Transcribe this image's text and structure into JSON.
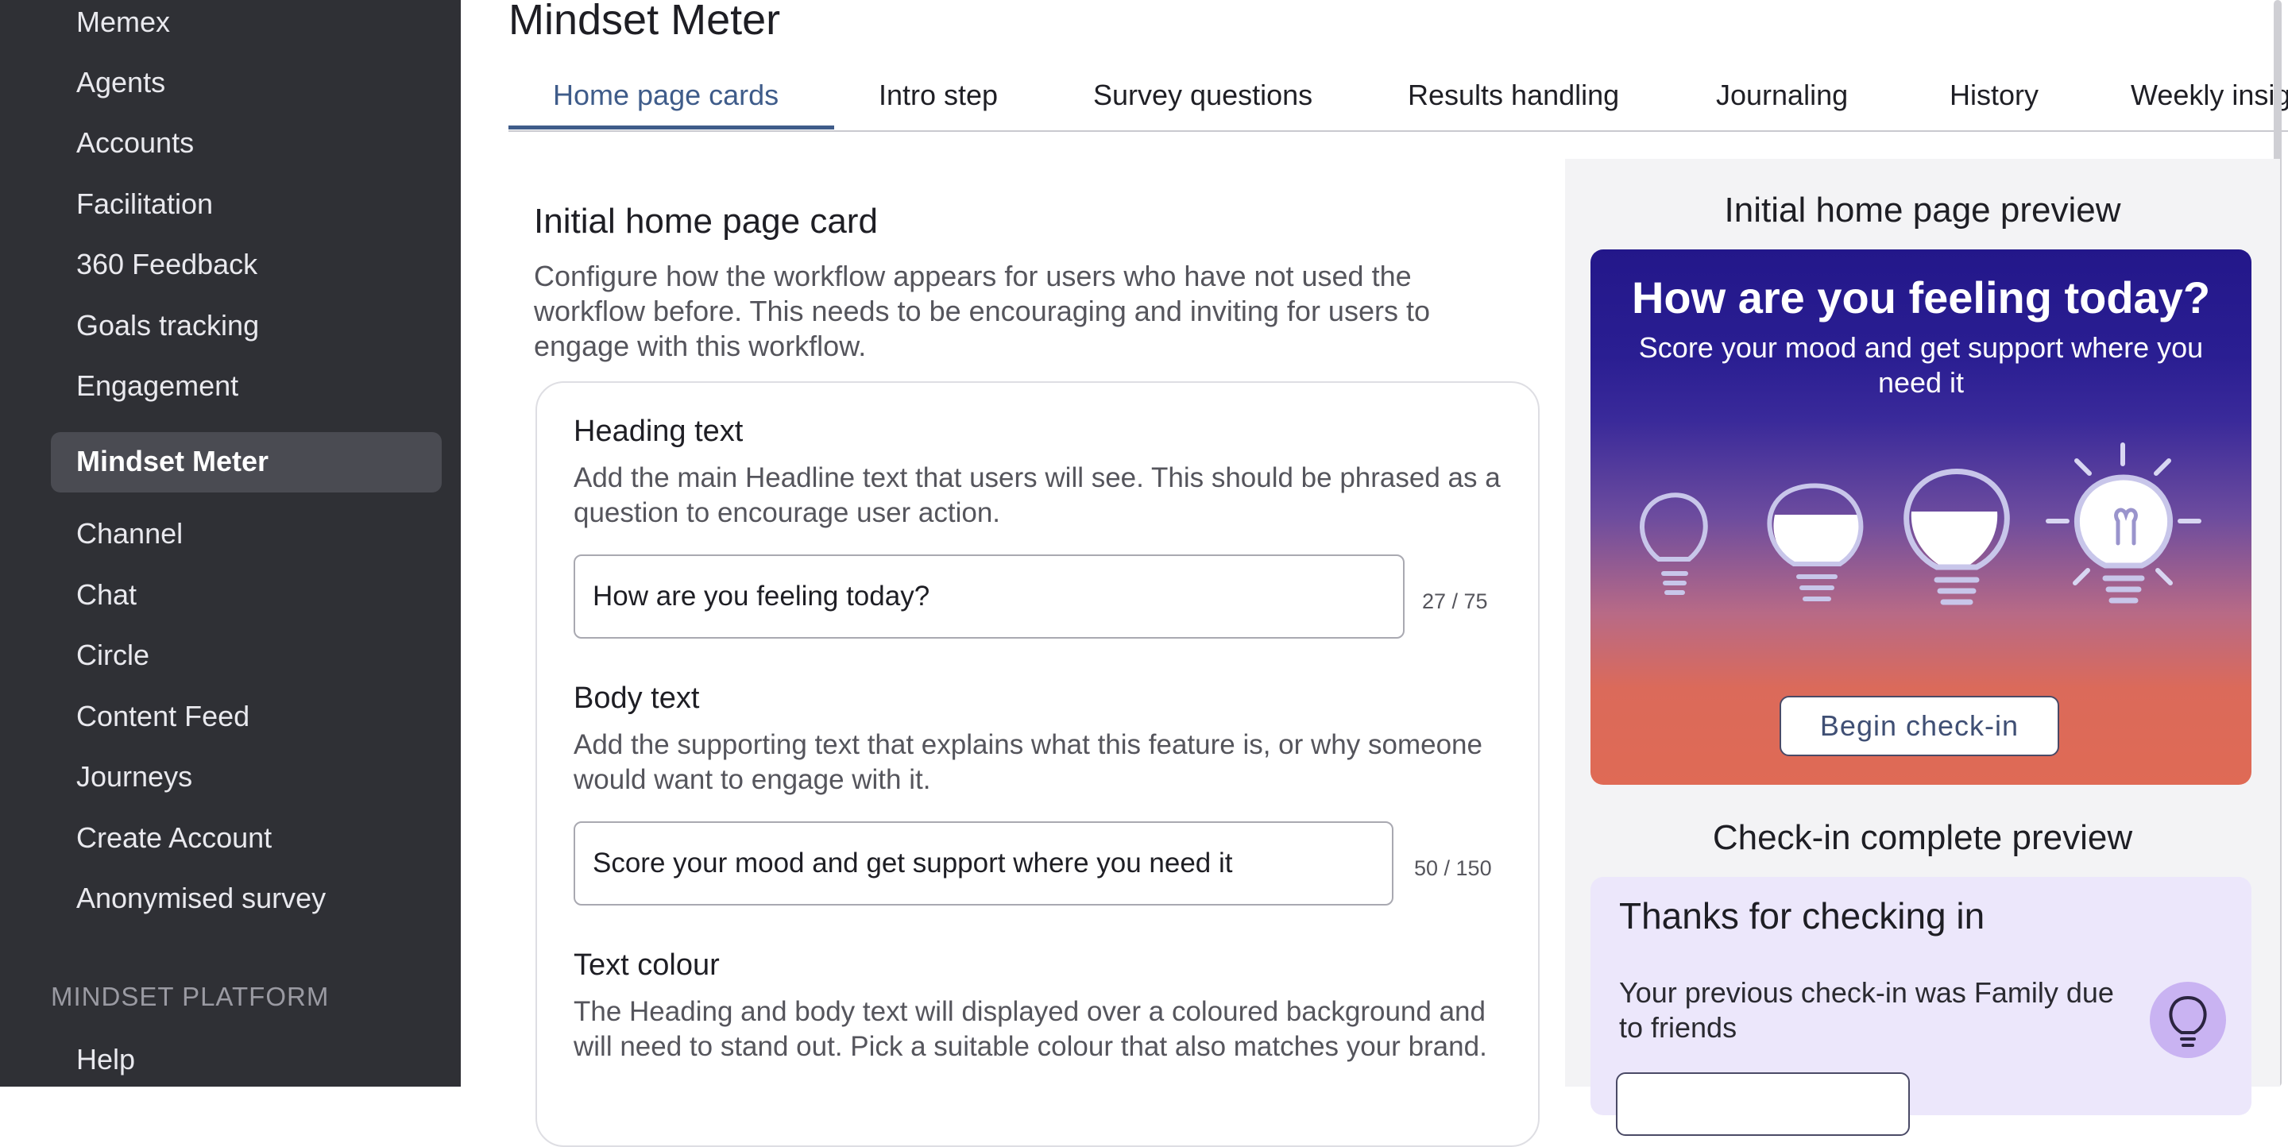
{
  "sidebar": {
    "items": [
      {
        "label": "Memex"
      },
      {
        "label": "Agents"
      },
      {
        "label": "Accounts"
      },
      {
        "label": "Facilitation"
      },
      {
        "label": "360 Feedback"
      },
      {
        "label": "Goals tracking"
      },
      {
        "label": "Engagement"
      },
      {
        "label": "Mindset Meter",
        "active": true
      },
      {
        "label": "Channel"
      },
      {
        "label": "Chat"
      },
      {
        "label": "Circle"
      },
      {
        "label": "Content Feed"
      },
      {
        "label": "Journeys"
      },
      {
        "label": "Create Account"
      },
      {
        "label": "Anonymised survey"
      }
    ],
    "section_label": "MINDSET PLATFORM",
    "section_items": [
      {
        "label": "Help"
      }
    ]
  },
  "page": {
    "title": "Mindset Meter",
    "tabs": [
      {
        "label": "Home page cards",
        "active": true
      },
      {
        "label": "Intro step"
      },
      {
        "label": "Survey questions"
      },
      {
        "label": "Results handling"
      },
      {
        "label": "Journaling"
      },
      {
        "label": "History"
      },
      {
        "label": "Weekly insig"
      }
    ]
  },
  "form": {
    "section_title": "Initial home page card",
    "section_desc": "Configure how the workflow appears for users who have not used the workflow before.  This needs to be encouraging and inviting for users to engage with this workflow.",
    "heading": {
      "label": "Heading text",
      "help": "Add the main Headline text that users will see. This should be phrased as a question to encourage user action.",
      "value": "How are you feeling today?",
      "counter": "27 / 75"
    },
    "body": {
      "label": "Body text",
      "help": "Add the supporting text that explains what this feature is, or why someone would want to engage with it.",
      "value": "Score your mood and get support where you need it",
      "counter": "50 / 150"
    },
    "text_colour": {
      "label": "Text colour",
      "help": "The Heading and body text will displayed over a coloured background and will need to stand out. Pick a suitable colour that also matches your brand."
    }
  },
  "preview": {
    "initial_title": "Initial home page preview",
    "hero_heading": "How are you feeling today?",
    "hero_body": "Score your mood and get support where you need it",
    "hero_button": "Begin check-in",
    "complete_title": "Check-in complete preview",
    "complete_card_title": "Thanks for checking in",
    "complete_card_body": "Your previous check-in was Family due to friends",
    "bulb_icons": [
      "empty-bulb-icon",
      "quarter-bulb-icon",
      "half-bulb-icon",
      "glowing-bulb-icon"
    ],
    "colors": {
      "hero_top": "#23178a",
      "hero_bottom": "#df6a55",
      "complete_card_bg": "#ece7fb",
      "sidebar_bg": "#2f3035",
      "tab_active": "#3f5c8a"
    }
  }
}
